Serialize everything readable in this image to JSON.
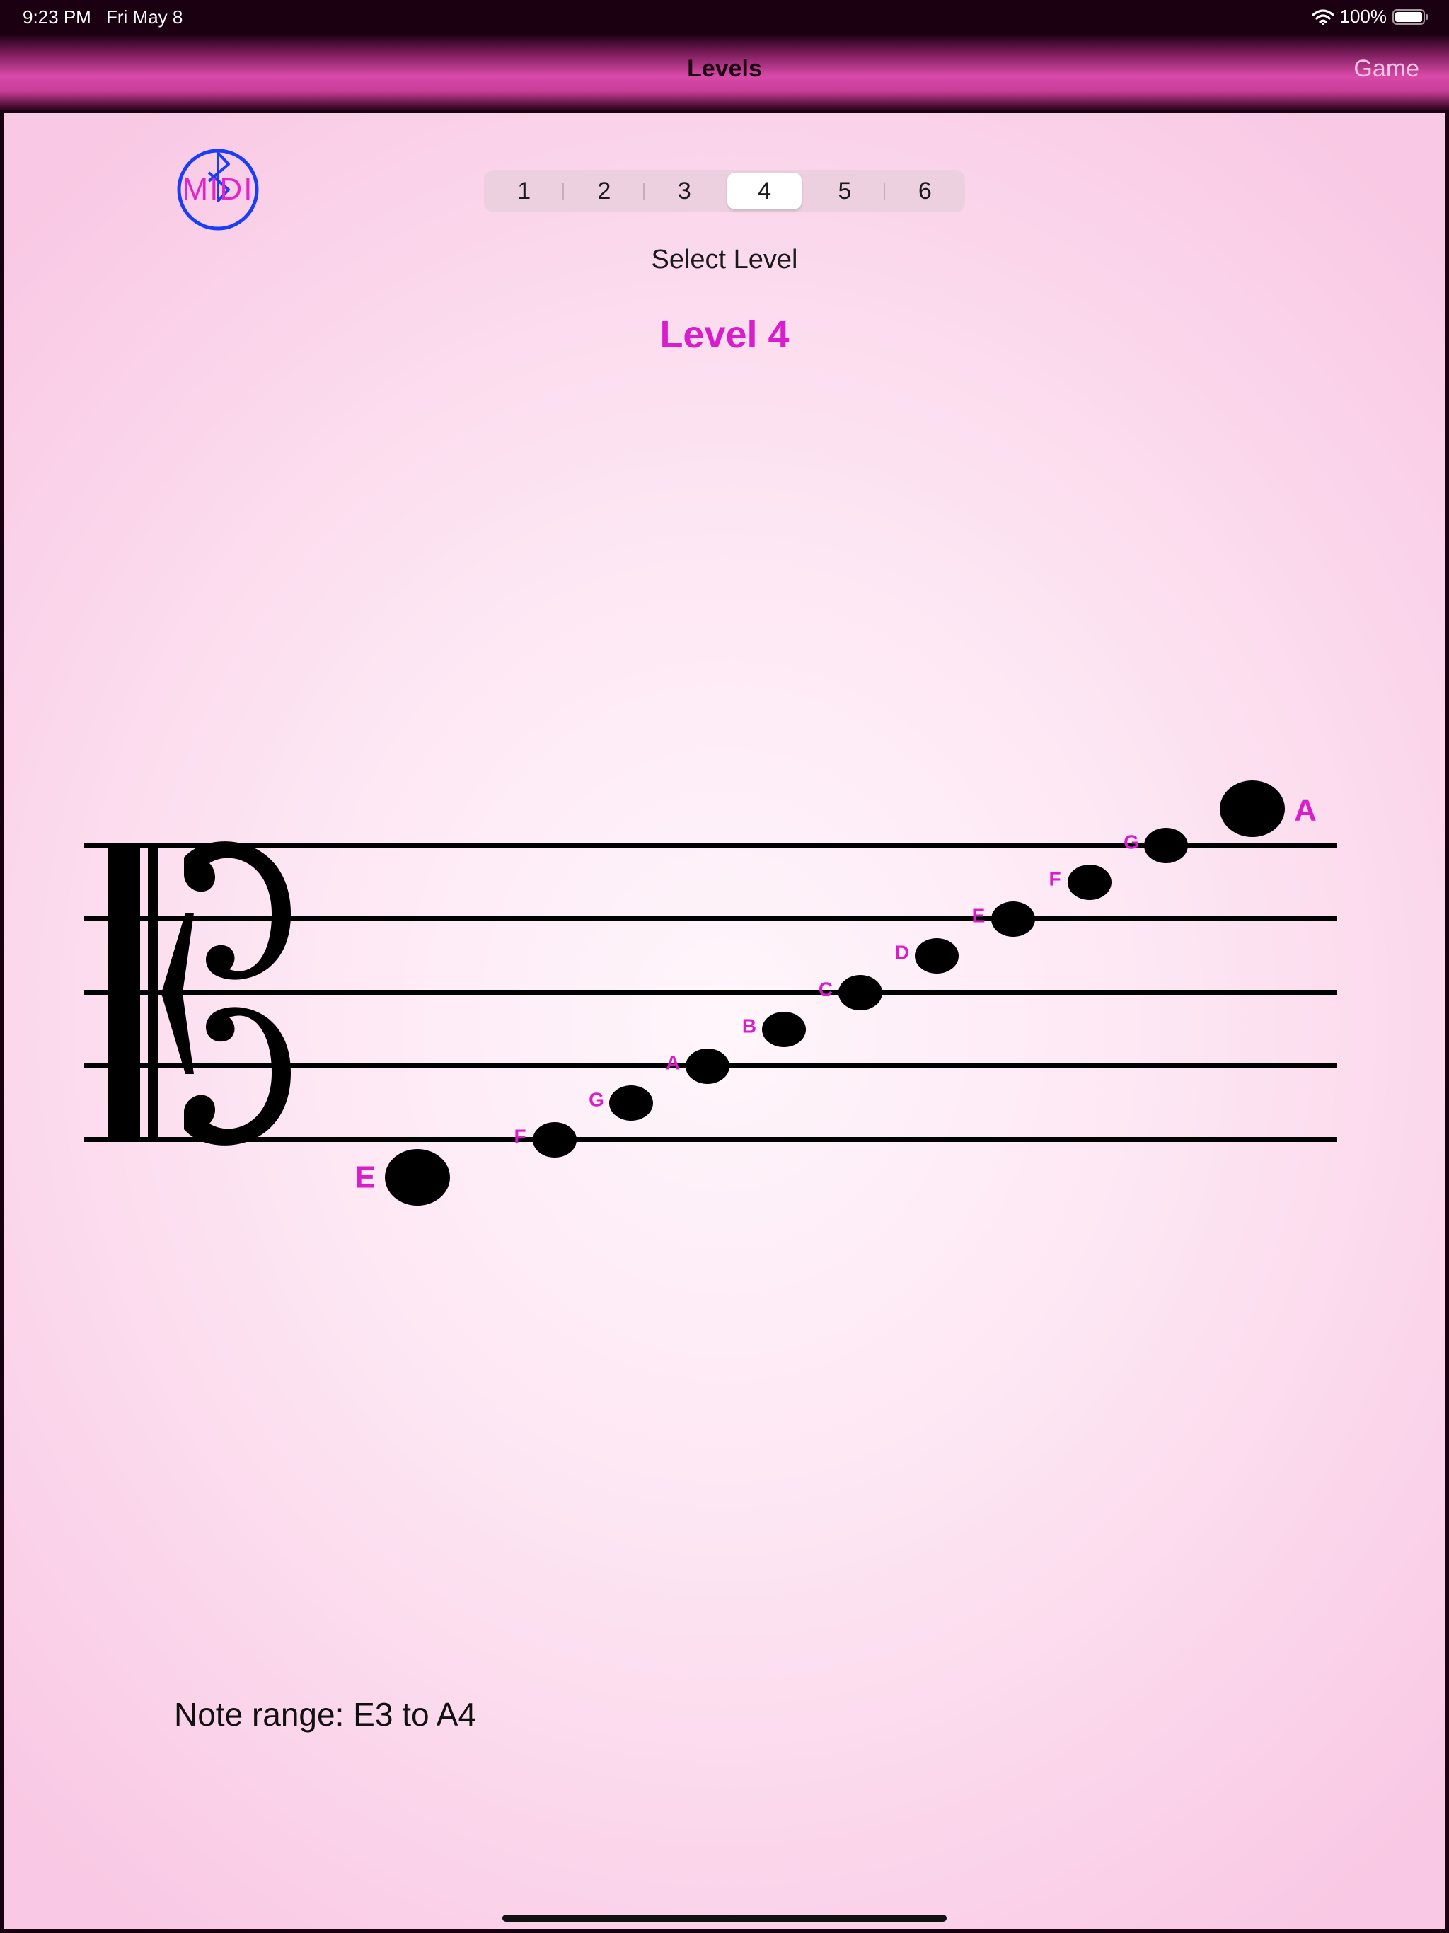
{
  "status_bar": {
    "time": "9:23 PM",
    "date": "Fri May 8",
    "battery": "100%",
    "icons": [
      "wifi-icon",
      "battery-icon"
    ]
  },
  "nav": {
    "title": "Levels",
    "right_button": "Game"
  },
  "midi": {
    "label": "MIDI",
    "icon": "bluetooth-icon",
    "color": "#1a3ef5",
    "text_color": "#e026c8"
  },
  "levels": {
    "options": [
      "1",
      "2",
      "3",
      "4",
      "5",
      "6"
    ],
    "selected": "4",
    "caption": "Select Level",
    "title": "Level 4"
  },
  "staff": {
    "clef": "alto-clef",
    "notes": [
      {
        "name": "E",
        "emphasis": true
      },
      {
        "name": "F",
        "emphasis": false
      },
      {
        "name": "G",
        "emphasis": false
      },
      {
        "name": "A",
        "emphasis": false
      },
      {
        "name": "B",
        "emphasis": false
      },
      {
        "name": "C",
        "emphasis": false
      },
      {
        "name": "D",
        "emphasis": false
      },
      {
        "name": "E",
        "emphasis": false
      },
      {
        "name": "F",
        "emphasis": false
      },
      {
        "name": "G",
        "emphasis": false
      },
      {
        "name": "A",
        "emphasis": true
      }
    ],
    "note_label_color": "#d81ecb"
  },
  "footer": {
    "note_range": "Note range:  E3 to A4"
  }
}
